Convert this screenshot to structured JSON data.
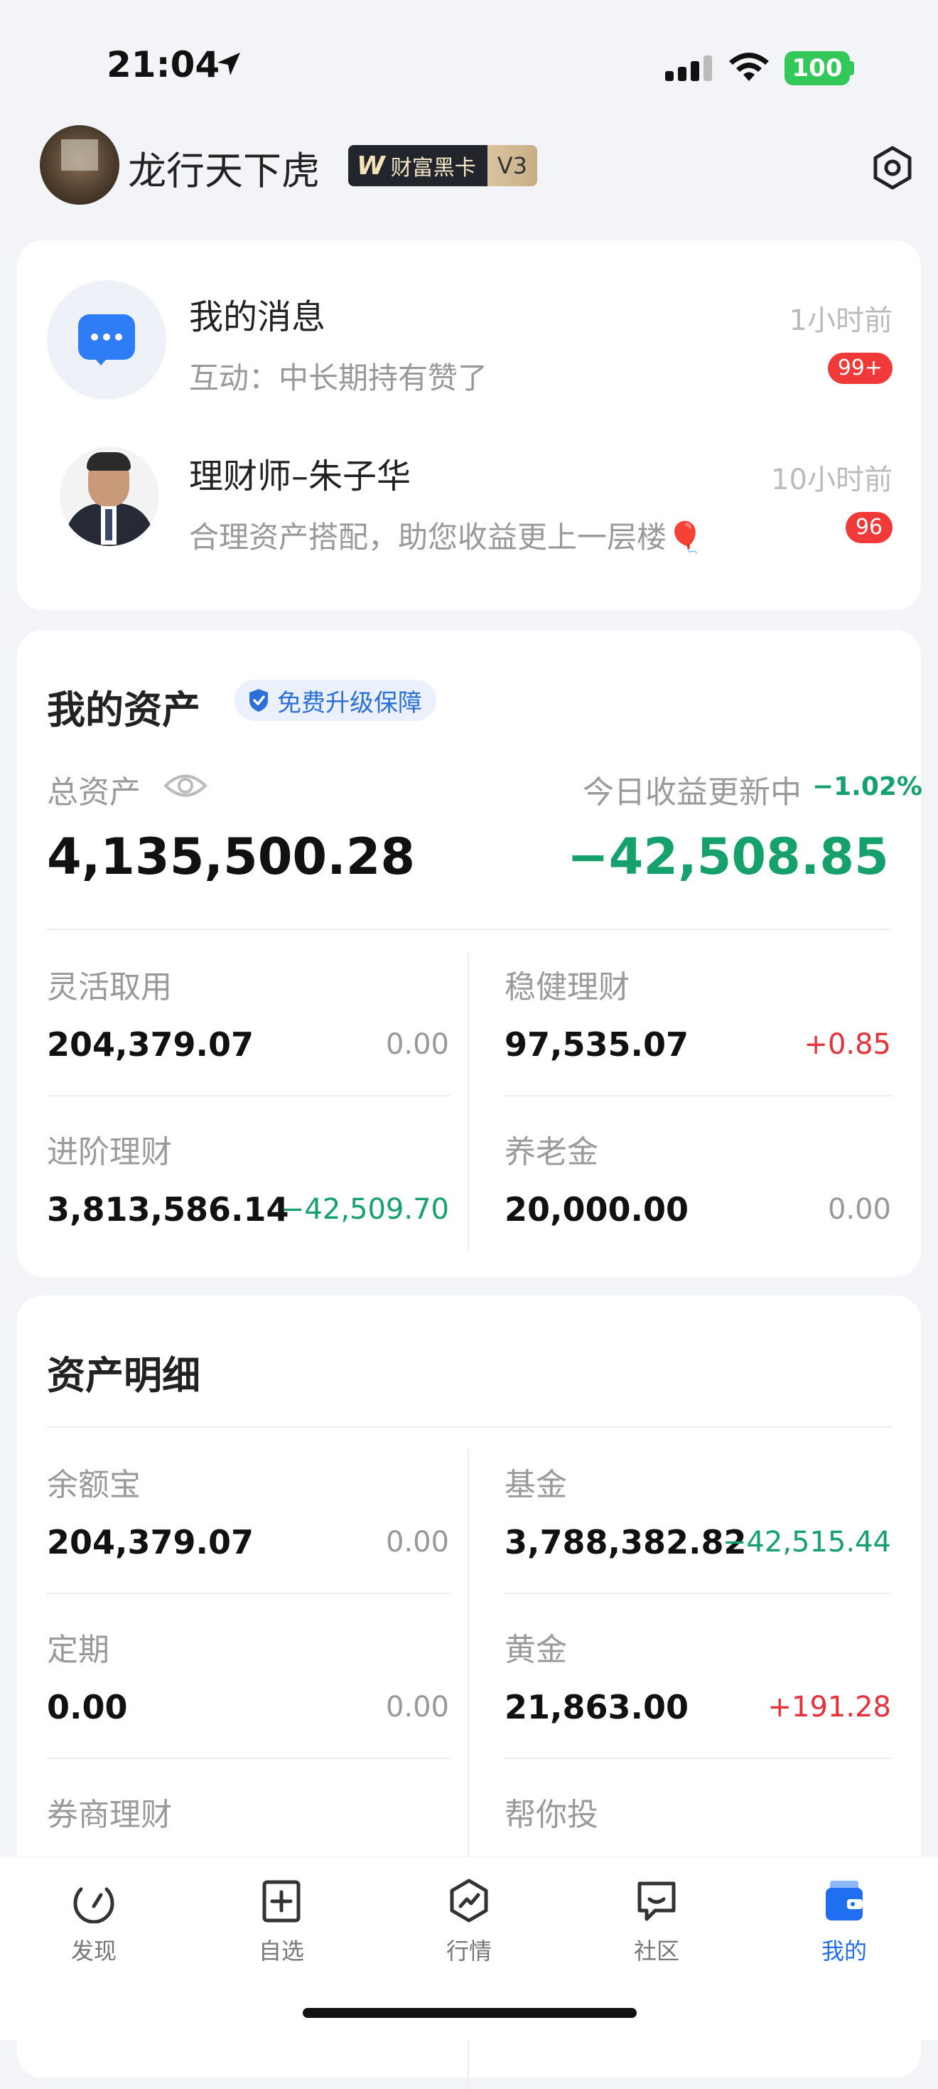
{
  "status_bar": {
    "time": "21:04",
    "battery": "100"
  },
  "profile": {
    "username": "龙行天下虎",
    "badge_brand": "W",
    "badge_text": "财富黑卡",
    "badge_level": "V3"
  },
  "messages": [
    {
      "title": "我的消息",
      "subtitle": "互动：中长期持有赞了",
      "time": "1小时前",
      "badge": "99+"
    },
    {
      "title": "理财师–朱子华",
      "subtitle": "合理资产搭配，助您收益更上一层楼🎈",
      "time": "10小时前",
      "badge": "96"
    }
  ],
  "assets": {
    "title": "我的资产",
    "upgrade_label": "免费升级保障",
    "total_label": "总资产",
    "total_value": "4,135,500.28",
    "today_label": "今日收益更新中",
    "today_pct": "−1.02%",
    "today_value": "−42,508.85",
    "items": [
      {
        "label": "灵活取用",
        "value": "204,379.07",
        "change": "0.00"
      },
      {
        "label": "稳健理财",
        "value": "97,535.07",
        "change": "+0.85"
      },
      {
        "label": "进阶理财",
        "value": "3,813,586.14",
        "change": "−42,509.70"
      },
      {
        "label": "养老金",
        "value": "20,000.00",
        "change": "0.00"
      }
    ]
  },
  "detail": {
    "title": "资产明细",
    "items": [
      {
        "label": "余额宝",
        "value": "204,379.07",
        "change": "0.00"
      },
      {
        "label": "基金",
        "value": "3,788,382.82",
        "change": "−42,515.44"
      },
      {
        "label": "定期",
        "value": "0.00",
        "change": "0.00"
      },
      {
        "label": "黄金",
        "value": "21,863.00",
        "change": "+191.28"
      },
      {
        "label": "券商理财"
      },
      {
        "label": "帮你投"
      }
    ]
  },
  "nav": [
    {
      "label": "发现",
      "icon": "discover-icon"
    },
    {
      "label": "自选",
      "icon": "watchlist-icon"
    },
    {
      "label": "行情",
      "icon": "market-icon"
    },
    {
      "label": "社区",
      "icon": "community-icon"
    },
    {
      "label": "我的",
      "icon": "wallet-icon",
      "active": true
    }
  ],
  "colors": {
    "accent": "#1f6ff0",
    "negative": "#16a06c",
    "positive": "#e5323a",
    "badge": "#f03a3a"
  }
}
